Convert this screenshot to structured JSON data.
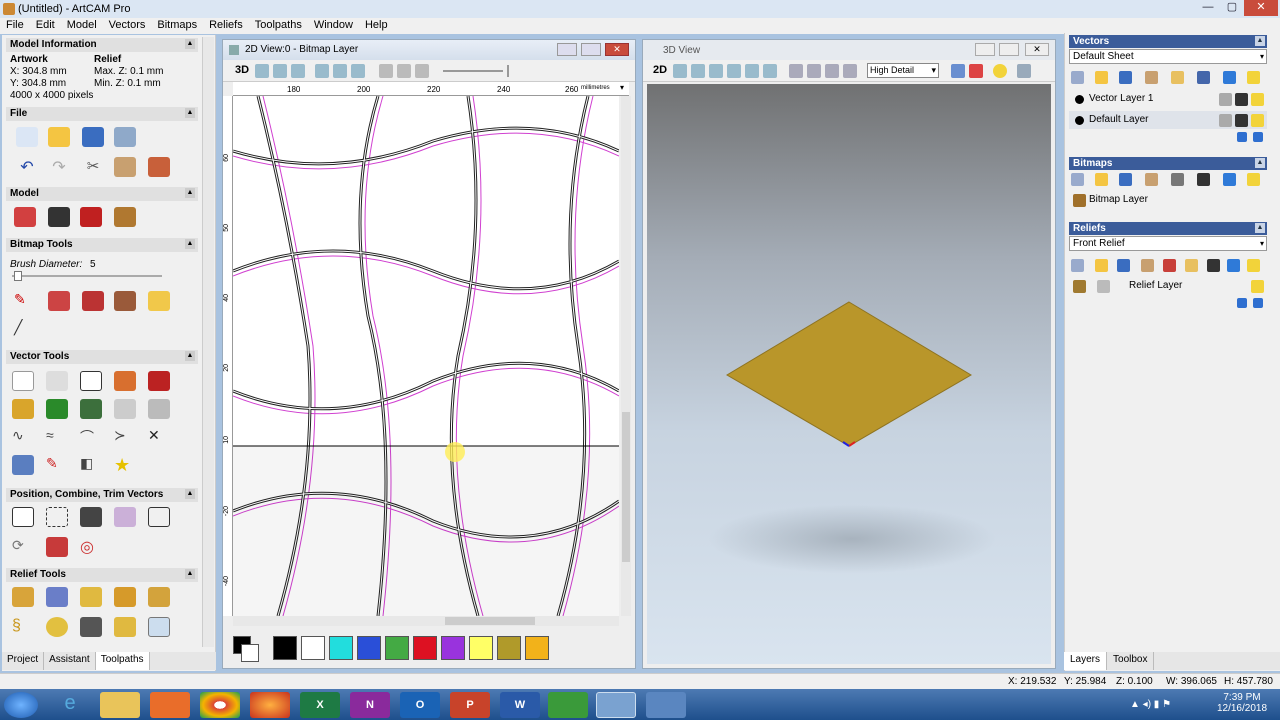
{
  "window": {
    "title": "(Untitled) - ArtCAM Pro"
  },
  "menu": [
    "File",
    "Edit",
    "Model",
    "Vectors",
    "Bitmaps",
    "Reliefs",
    "Toolpaths",
    "Window",
    "Help"
  ],
  "left": {
    "model_info": {
      "header": "Model Information",
      "artwork_label": "Artwork",
      "relief_label": "Relief",
      "x": "X: 304.8 mm",
      "y": "Y: 304.8 mm",
      "maxz": "Max. Z: 0.1 mm",
      "minz": "Min. Z: 0.1 mm",
      "pixels": "4000 x 4000 pixels"
    },
    "sections": {
      "file": "File",
      "model": "Model",
      "bitmap_tools": "Bitmap Tools",
      "vector_tools": "Vector Tools",
      "position": "Position, Combine, Trim Vectors",
      "relief_tools": "Relief Tools"
    },
    "brush_label": "Brush Diameter:",
    "brush_value": "5",
    "tabs": [
      "Project",
      "Assistant",
      "Toolpaths"
    ]
  },
  "view2d": {
    "title": "2D View:0 - Bitmap Layer",
    "mode": "3D",
    "ruler_top": [
      "180",
      "200",
      "220",
      "240",
      "260"
    ],
    "units": "millimetres",
    "ruler_left": [
      "60",
      "50",
      "40",
      "20",
      "10",
      "-20",
      "-40"
    ]
  },
  "view3d": {
    "title": "3D View",
    "mode": "2D",
    "detail": "High Detail"
  },
  "palette": [
    "#000000",
    "#ffffff",
    "#22dddd",
    "#2a4fd8",
    "#44aa44",
    "#dd1122",
    "#9933dd",
    "#ffff66",
    "#b09a2a",
    "#f2b21a"
  ],
  "right": {
    "vectors": {
      "header": "Vectors",
      "sheet": "Default Sheet",
      "layers": [
        "Vector Layer 1",
        "Default Layer"
      ]
    },
    "bitmaps": {
      "header": "Bitmaps",
      "layers": [
        "Bitmap Layer"
      ]
    },
    "reliefs": {
      "header": "Reliefs",
      "relief": "Front Relief",
      "layers": [
        "Relief Layer"
      ]
    },
    "tabs": [
      "Layers",
      "Toolbox"
    ]
  },
  "status": {
    "x": "X: 219.532",
    "y": "Y: 25.984",
    "z": "Z: 0.100",
    "w": "W: 396.065",
    "h": "H: 457.780"
  },
  "taskbar": {
    "time": "7:39 PM",
    "date": "12/16/2018"
  }
}
